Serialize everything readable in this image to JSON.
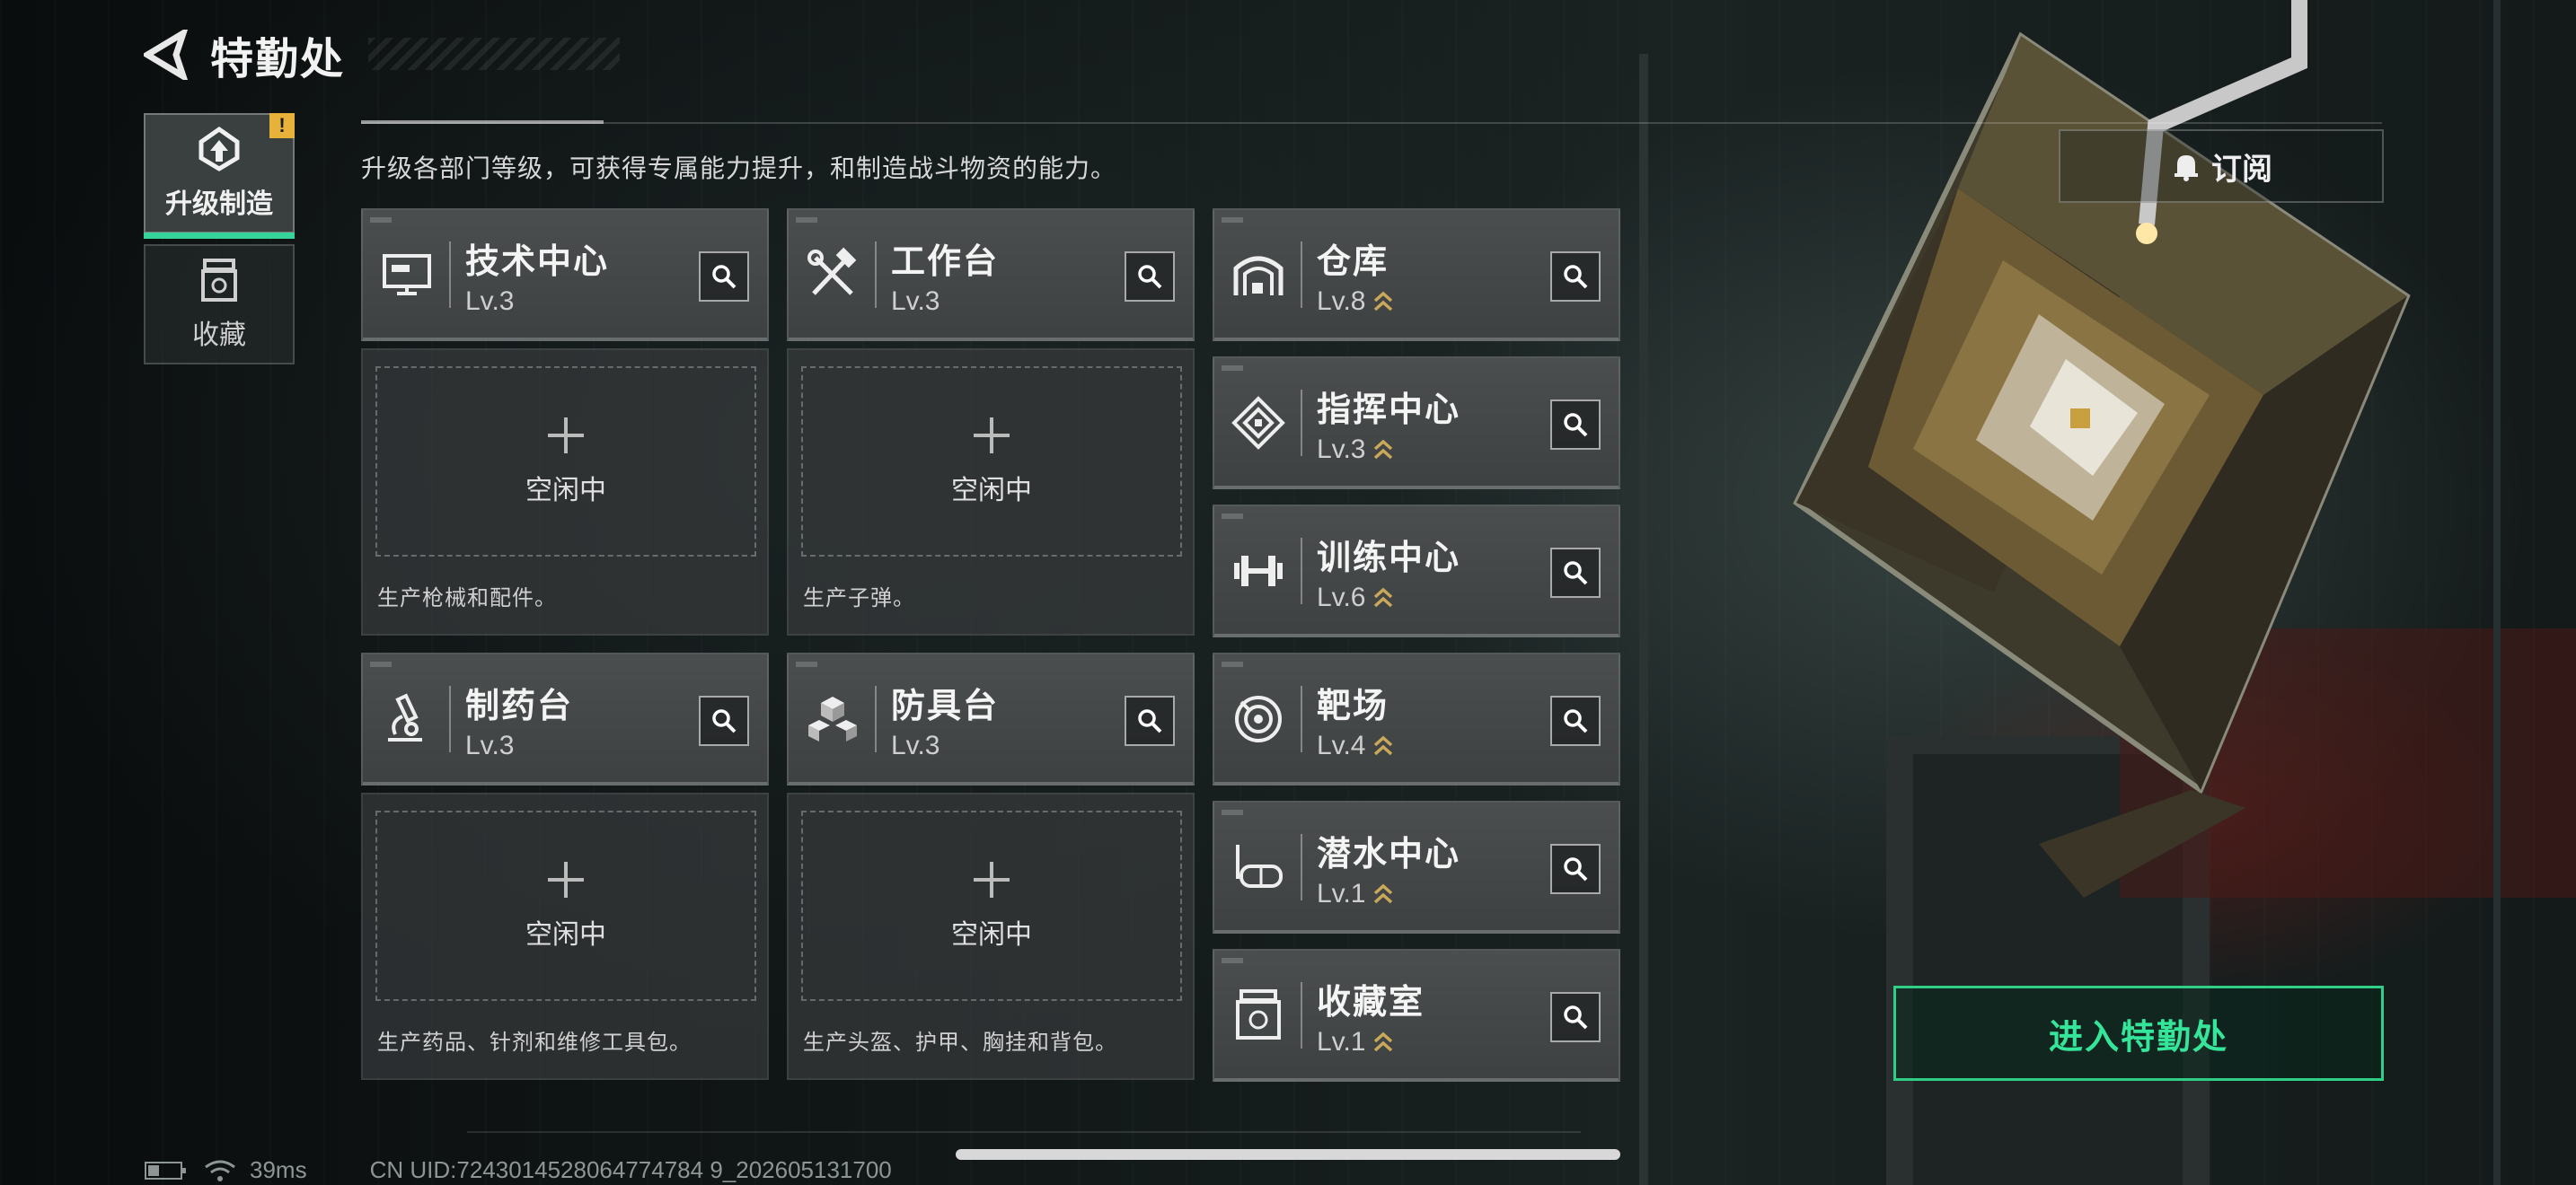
{
  "header": {
    "title": "特勤处"
  },
  "tabs": [
    {
      "label": "升级制造",
      "badge": "!"
    },
    {
      "label": "收藏"
    }
  ],
  "description": "升级各部门等级，可获得专属能力提升，和制造战斗物资的能力。",
  "cards": [
    {
      "name": "技术中心",
      "level": "Lv.3",
      "icon": "monitor-icon"
    },
    {
      "name": "工作台",
      "level": "Lv.3",
      "icon": "tools-icon"
    },
    {
      "name": "仓库",
      "level": "Lv.8",
      "icon": "warehouse-icon",
      "upgradable": true
    },
    {
      "name": "指挥中心",
      "level": "Lv.3",
      "icon": "command-icon",
      "upgradable": true
    },
    {
      "name": "训练中心",
      "level": "Lv.6",
      "icon": "dumbbell-icon",
      "upgradable": true
    },
    {
      "name": "制药台",
      "level": "Lv.3",
      "icon": "microscope-icon"
    },
    {
      "name": "防具台",
      "level": "Lv.3",
      "icon": "cubes-icon"
    },
    {
      "name": "靶场",
      "level": "Lv.4",
      "icon": "target-icon",
      "upgradable": true
    },
    {
      "name": "潜水中心",
      "level": "Lv.1",
      "icon": "diving-mask-icon",
      "upgradable": true
    },
    {
      "name": "收藏室",
      "level": "Lv.1",
      "icon": "collection-icon",
      "upgradable": true
    }
  ],
  "production": [
    {
      "status": "空闲中",
      "desc": "生产枪械和配件。"
    },
    {
      "status": "空闲中",
      "desc": "生产子弹。"
    },
    {
      "status": "空闲中",
      "desc": "生产药品、针剂和维修工具包。"
    },
    {
      "status": "空闲中",
      "desc": "生产头盔、护甲、胸挂和背包。"
    }
  ],
  "subscribe_label": "订阅",
  "enter_label": "进入特勤处",
  "status_bar": {
    "ping": "39ms",
    "uid": "CN UID:7243014528064774784 9_202605131700"
  },
  "colors": {
    "accent": "#36d39a",
    "upgrade": "#c9a85a",
    "badge": "#e7b23a"
  }
}
